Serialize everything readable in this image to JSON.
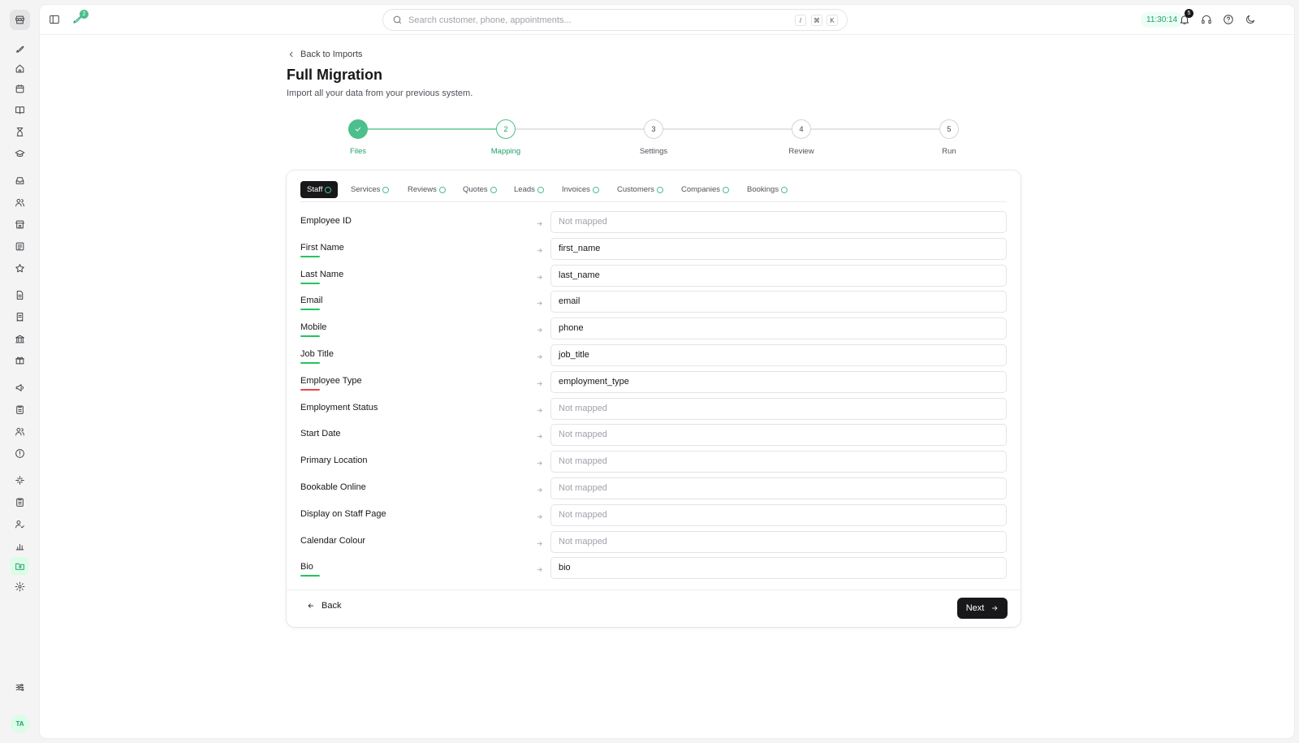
{
  "sidebar": {
    "icons": [
      "rocket-icon",
      "home-icon",
      "calendar-icon",
      "book-icon",
      "hourglass-icon",
      "graduation-cap-icon",
      "inbox-icon",
      "users-icon",
      "store-icon",
      "list-icon",
      "star-icon",
      "document-icon",
      "receipt-icon",
      "bank-icon",
      "gift-icon",
      "megaphone-icon",
      "clipboard-icon",
      "team-icon",
      "alert-icon",
      "sparkle-icon",
      "checklist-icon",
      "user-check-icon",
      "bar-chart-icon",
      "folder-import-icon",
      "settings-icon",
      "sliders-icon"
    ],
    "active_icon": "folder-import-icon",
    "avatar_initials": "TA"
  },
  "topbar": {
    "updates_badge": "2",
    "search_placeholder": "Search customer, phone, appointments...",
    "shortcut_keys": [
      "/",
      "⌘",
      "K"
    ],
    "clock": "11:30:14",
    "notifications_badge": "5"
  },
  "header": {
    "back_label": "Back to Imports",
    "title": "Full Migration",
    "subtitle": "Import all your data from your previous system."
  },
  "stepper": {
    "steps": [
      {
        "number": "1",
        "label": "Files",
        "state": "done"
      },
      {
        "number": "2",
        "label": "Mapping",
        "state": "current"
      },
      {
        "number": "3",
        "label": "Settings",
        "state": "todo"
      },
      {
        "number": "4",
        "label": "Review",
        "state": "todo"
      },
      {
        "number": "5",
        "label": "Run",
        "state": "todo"
      }
    ]
  },
  "tabs": [
    {
      "label": "Staff",
      "active": true
    },
    {
      "label": "Services"
    },
    {
      "label": "Reviews"
    },
    {
      "label": "Quotes"
    },
    {
      "label": "Leads"
    },
    {
      "label": "Invoices"
    },
    {
      "label": "Customers"
    },
    {
      "label": "Companies"
    },
    {
      "label": "Bookings"
    }
  ],
  "mapping": {
    "placeholder": "Not mapped",
    "rows": [
      {
        "label": "Employee ID",
        "value": "Not mapped",
        "mapped": false,
        "indicator": "none"
      },
      {
        "label": "First Name",
        "value": "first_name",
        "mapped": true,
        "indicator": "green"
      },
      {
        "label": "Last Name",
        "value": "last_name",
        "mapped": true,
        "indicator": "green"
      },
      {
        "label": "Email",
        "value": "email",
        "mapped": true,
        "indicator": "green"
      },
      {
        "label": "Mobile",
        "value": "phone",
        "mapped": true,
        "indicator": "green"
      },
      {
        "label": "Job Title",
        "value": "job_title",
        "mapped": true,
        "indicator": "green"
      },
      {
        "label": "Employee Type",
        "value": "employment_type",
        "mapped": true,
        "indicator": "red"
      },
      {
        "label": "Employment Status",
        "value": "Not mapped",
        "mapped": false,
        "indicator": "none"
      },
      {
        "label": "Start Date",
        "value": "Not mapped",
        "mapped": false,
        "indicator": "none"
      },
      {
        "label": "Primary Location",
        "value": "Not mapped",
        "mapped": false,
        "indicator": "none"
      },
      {
        "label": "Bookable Online",
        "value": "Not mapped",
        "mapped": false,
        "indicator": "none"
      },
      {
        "label": "Display on Staff Page",
        "value": "Not mapped",
        "mapped": false,
        "indicator": "none"
      },
      {
        "label": "Calendar Colour",
        "value": "Not mapped",
        "mapped": false,
        "indicator": "none"
      },
      {
        "label": "Bio",
        "value": "bio",
        "mapped": true,
        "indicator": "green"
      }
    ]
  },
  "footer": {
    "back_label": "Back",
    "next_label": "Next"
  },
  "colors": {
    "accent": "#22a06b",
    "success": "#22c55e",
    "error": "#ef4444",
    "dark": "#18181b"
  }
}
